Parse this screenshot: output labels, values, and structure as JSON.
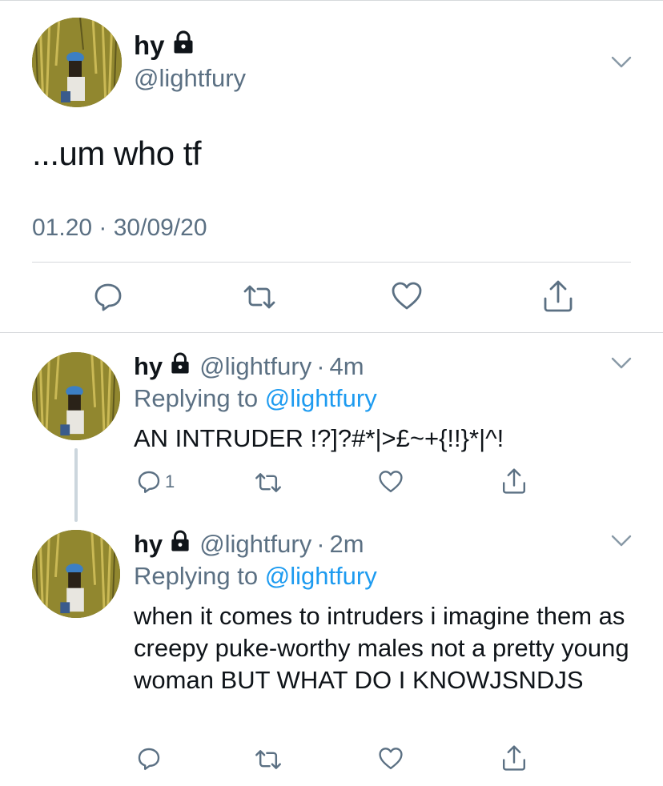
{
  "main_tweet": {
    "display_name": "hy",
    "handle": "@lightfury",
    "text": "...um who tf",
    "timestamp": "01.20 · 30/09/20",
    "icons": [
      "lock-icon",
      "chevron-down-icon",
      "reply-icon",
      "retweet-icon",
      "like-icon",
      "share-icon"
    ]
  },
  "replies": [
    {
      "display_name": "hy",
      "handle": "@lightfury",
      "dot": "·",
      "time_ago": "4m",
      "replying_prefix": "Replying to",
      "replying_to": "@lightfury",
      "text": "AN INTRUDER !?]?#*|>£~+{!!}*|^!",
      "reply_count": "1"
    },
    {
      "display_name": "hy",
      "handle": "@lightfury",
      "dot": "·",
      "time_ago": "2m",
      "replying_prefix": "Replying to",
      "replying_to": "@lightfury",
      "text": "when it comes to intruders i imagine them as creepy puke-worthy males not a pretty young woman BUT WHAT DO I KNOWJSNDJS",
      "reply_count": ""
    }
  ],
  "colors": {
    "text": "#0f1419",
    "secondary": "#5b7083",
    "link": "#1d9bf0",
    "divider": "#d6d9dc"
  }
}
